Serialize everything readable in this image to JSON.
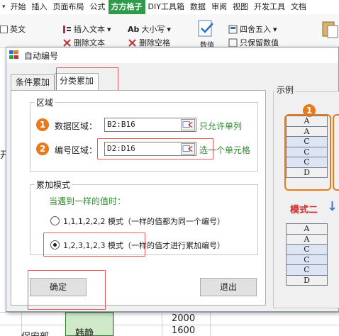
{
  "menu": {
    "items": [
      "开始",
      "插入",
      "页面布局",
      "公式",
      "方方格子",
      "DIY工具箱",
      "数据",
      "审阅",
      "视图",
      "开发工具",
      "文档"
    ],
    "active_index": 4
  },
  "ribbon": {
    "english_label": "英文",
    "insert_text": "插入文本",
    "delete_text": "删除文本",
    "case_label": "大小写",
    "delete_space": "删除空格",
    "data_label": "数值",
    "round_label": "四舍五入",
    "keep_label": "只保留数值"
  },
  "sheet": {
    "cell_1": "2000",
    "cell_2": "韩静",
    "cell_3": "1600",
    "cell_4": "保安部",
    "cell_left_fragment": "开"
  },
  "dialog": {
    "title": "自动编号",
    "tabs": [
      "条件累加",
      "分类累加"
    ],
    "selected_tab": 1,
    "region": {
      "legend": "区域",
      "data_badge": "1",
      "data_label": "数据区域：",
      "data_value": "B2:B16",
      "data_hint": "只允许单列",
      "number_badge": "2",
      "number_label": "编号区域：",
      "number_value": "D2:D16",
      "number_hint": "选一个单元格"
    },
    "mode": {
      "legend": "累加模式",
      "prompt": "当遇到一样的值时：",
      "option1": "1,1,1,2,2,2 模式（一样的值都为同一个编号）",
      "option2": "1,2,3,1,2,3 模式（一样的值才进行累加编号）",
      "selected": 2
    },
    "ok_label": "确定",
    "exit_label": "退出",
    "example": {
      "legend": "示例",
      "badge": "1",
      "mode_label": "模式二",
      "arrow": "↓",
      "top_values": [
        "A",
        "A",
        "C",
        "C",
        "C",
        "D"
      ],
      "bottom_values": [
        "A",
        "A",
        "C",
        "C",
        "C",
        "D"
      ]
    }
  },
  "colors": {
    "accent_green": "#2f9b4a",
    "orange": "#e8791c",
    "highlight_red": "#e05c5c",
    "hint_green": "#2e8b2e",
    "cell_blue": "#dde5f3"
  }
}
